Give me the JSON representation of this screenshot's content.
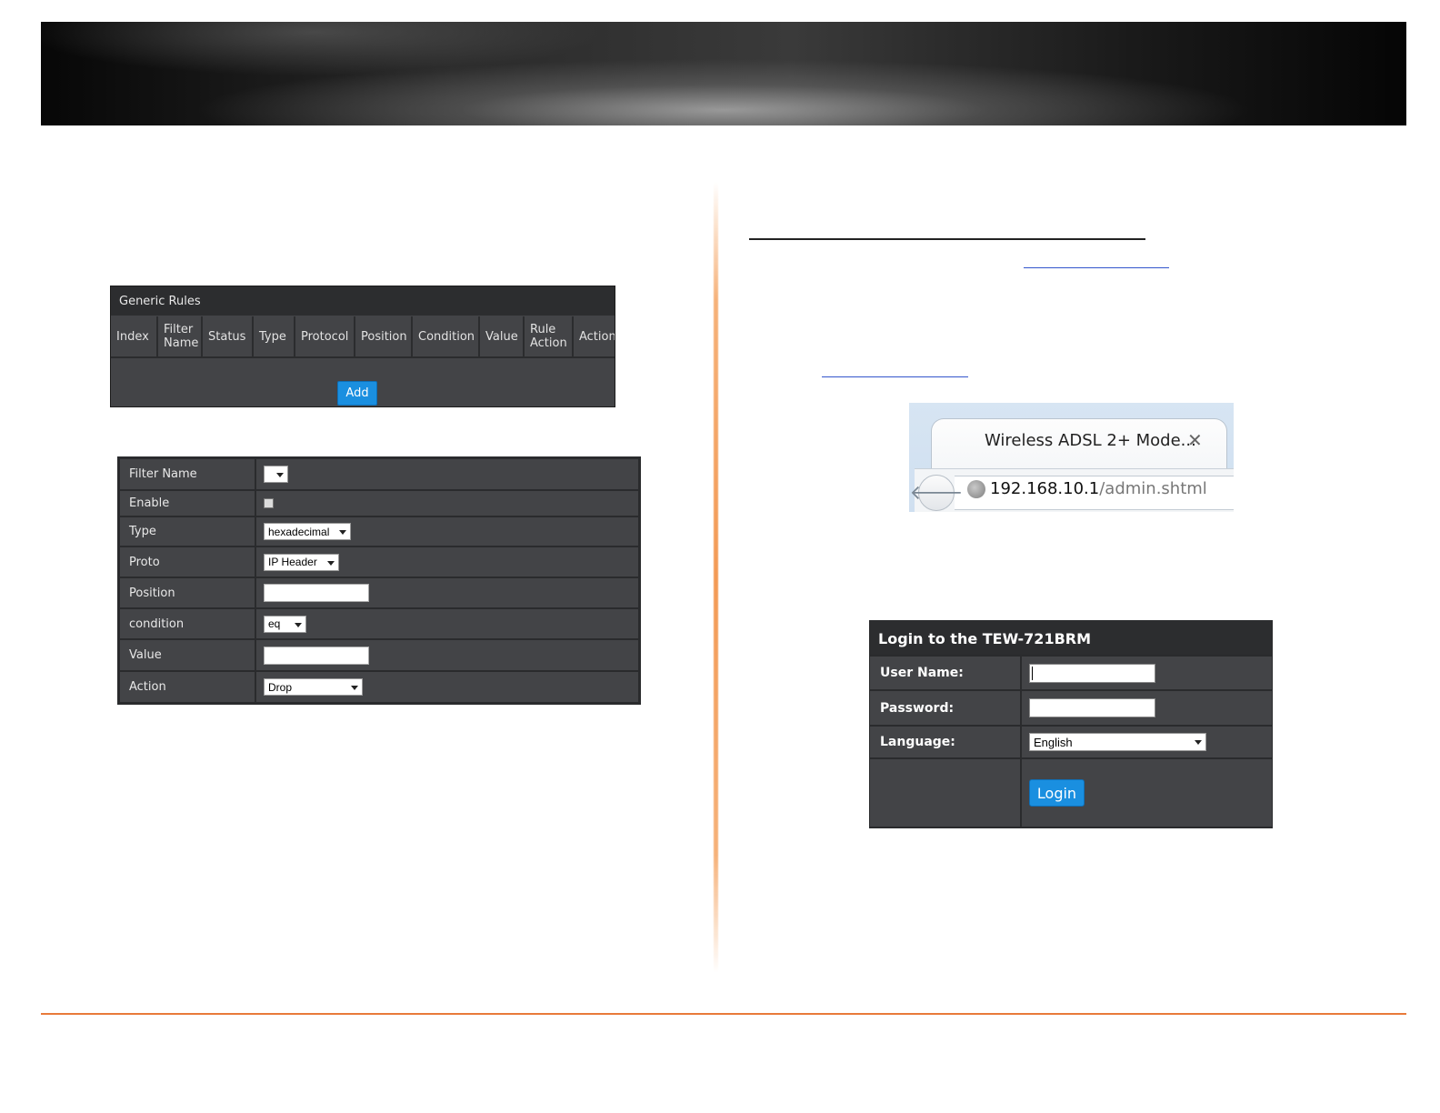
{
  "generic_rules": {
    "title": "Generic Rules",
    "columns": [
      {
        "line1": "Index",
        "line2": ""
      },
      {
        "line1": "Filter",
        "line2": "Name"
      },
      {
        "line1": "Status",
        "line2": ""
      },
      {
        "line1": "Type",
        "line2": ""
      },
      {
        "line1": "Protocol",
        "line2": ""
      },
      {
        "line1": "Position",
        "line2": ""
      },
      {
        "line1": "Condition",
        "line2": ""
      },
      {
        "line1": "Value",
        "line2": ""
      },
      {
        "line1": "Rule",
        "line2": "Action"
      },
      {
        "line1": "Action",
        "line2": ""
      }
    ],
    "add_label": "Add"
  },
  "filter_form": {
    "filter_name_label": "Filter Name",
    "enable_label": "Enable",
    "type_label": "Type",
    "type_value": "hexadecimal",
    "proto_label": "Proto",
    "proto_value": "IP Header",
    "position_label": "Position",
    "condition_label": "condition",
    "condition_value": "eq",
    "value_label": "Value",
    "action_label": "Action",
    "action_value": "Drop"
  },
  "browser": {
    "tab_title": "Wireless ADSL 2+ Mode...",
    "close_glyph": "✕",
    "back_glyph": "🡐",
    "address_host": "192.168.10.1",
    "address_path": "/admin.shtml"
  },
  "login": {
    "title": "Login to the TEW-721BRM",
    "username_label": "User Name:",
    "password_label": "Password:",
    "language_label": "Language:",
    "language_value": "English",
    "login_button": "Login"
  },
  "colors": {
    "accent_orange": "#e87a3a",
    "button_blue": "#1a8fe0",
    "panel_gray": "#434447"
  }
}
